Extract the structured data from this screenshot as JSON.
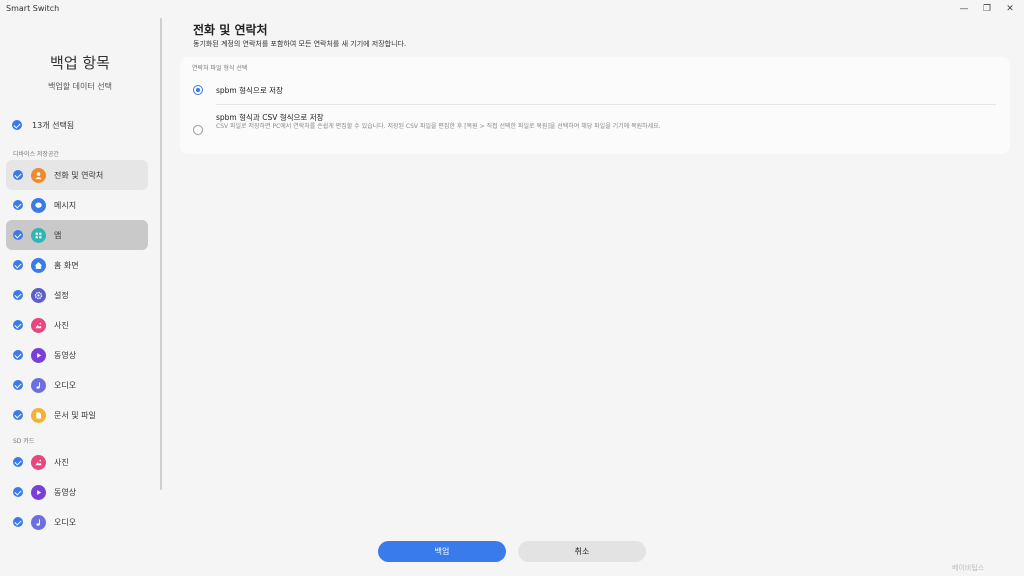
{
  "window": {
    "title": "Smart Switch",
    "minimize_icon": "minimize-icon",
    "restore_icon": "restore-icon",
    "close_icon": "close-icon"
  },
  "sidebar": {
    "title": "백업 항목",
    "subtitle": "백업할 데이터 선택",
    "select_all": {
      "label": "13개 선택됨",
      "checked": true
    },
    "device_section": "디바이스 저장공간",
    "device_items": [
      {
        "label": "전화 및 연락처",
        "icon": "contacts-icon",
        "color": "#f08b2d",
        "checked": true,
        "state": "highlighted"
      },
      {
        "label": "메시지",
        "icon": "message-icon",
        "color": "#3a7bec",
        "checked": true,
        "state": ""
      },
      {
        "label": "앱",
        "icon": "apps-icon",
        "color": "#2fb5b5",
        "checked": true,
        "state": "selected"
      },
      {
        "label": "홈 화면",
        "icon": "home-icon",
        "color": "#3a7bec",
        "checked": true,
        "state": ""
      },
      {
        "label": "설정",
        "icon": "settings-icon",
        "color": "#5b5fc7",
        "checked": true,
        "state": ""
      },
      {
        "label": "사진",
        "icon": "gallery-icon",
        "color": "#e8467c",
        "checked": true,
        "state": ""
      },
      {
        "label": "동영상",
        "icon": "video-icon",
        "color": "#7b3fd8",
        "checked": true,
        "state": ""
      },
      {
        "label": "오디오",
        "icon": "audio-icon",
        "color": "#6b6fe0",
        "checked": true,
        "state": ""
      },
      {
        "label": "문서 및 파일",
        "icon": "document-icon",
        "color": "#f2b233",
        "checked": true,
        "state": ""
      }
    ],
    "sd_section": "SD 카드",
    "sd_items": [
      {
        "label": "사진",
        "icon": "gallery-icon",
        "color": "#e8467c",
        "checked": true
      },
      {
        "label": "동영상",
        "icon": "video-icon",
        "color": "#7b3fd8",
        "checked": true
      },
      {
        "label": "오디오",
        "icon": "audio-icon",
        "color": "#6b6fe0",
        "checked": true
      }
    ]
  },
  "main": {
    "title": "전화 및 연락처",
    "description": "동기화된 계정의 연락처를 포함하여 모든 연락처를 새 기기에 저장합니다.",
    "format_section": "연락처 파일 형식 선택",
    "options": [
      {
        "label": "spbm 형식으로 저장",
        "selected": true
      },
      {
        "label": "spbm 형식과 CSV 형식으로 저장",
        "description": "CSV 파일로 저장하면 PC에서 연락처를 손쉽게 편집할 수 있습니다. 저장된 CSV 파일을 편집한 후 [복원 > 직접 선택한 파일로 복원]을 선택하여 해당 파일을 기기에 복원하세요.",
        "selected": false
      }
    ]
  },
  "footer": {
    "backup_label": "백업",
    "cancel_label": "취소"
  },
  "watermark": "베이비팁스"
}
